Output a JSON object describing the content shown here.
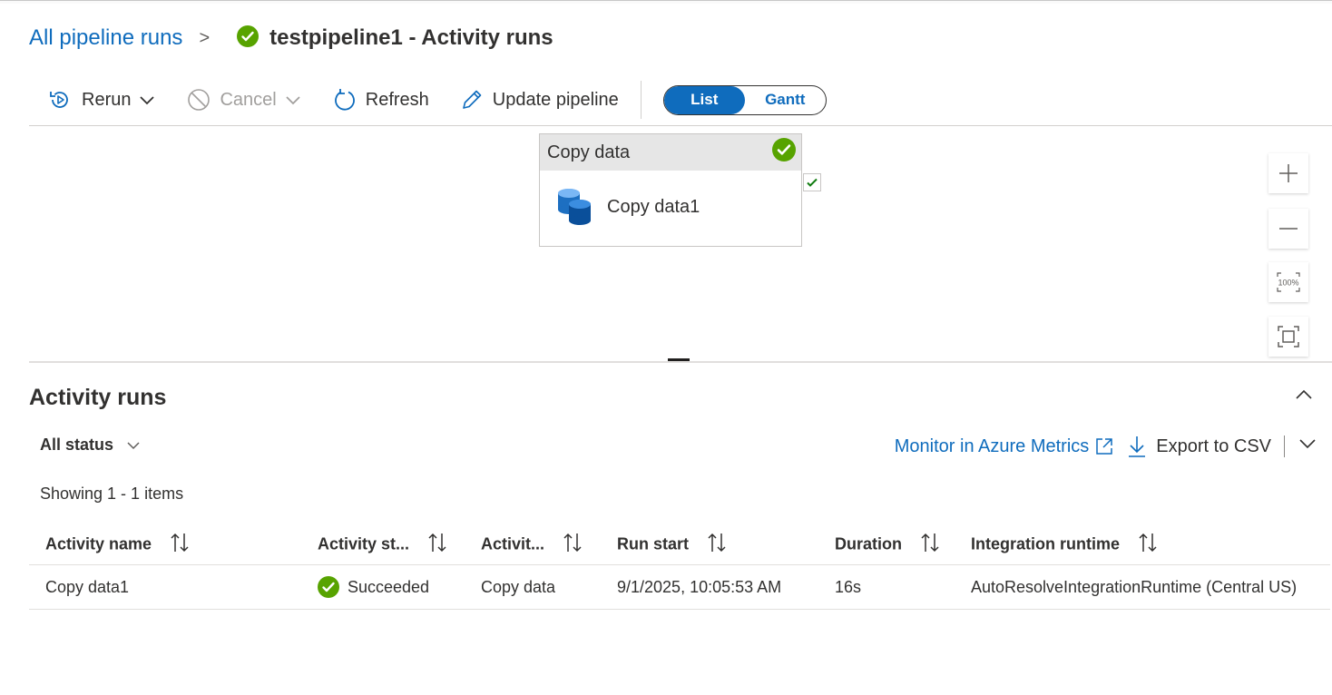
{
  "breadcrumb": {
    "parent": "All pipeline runs",
    "separator": ">",
    "title": "testpipeline1 - Activity runs"
  },
  "toolbar": {
    "rerun": "Rerun",
    "cancel": "Cancel",
    "refresh": "Refresh",
    "update_pipeline": "Update pipeline",
    "view_toggle": {
      "list": "List",
      "gantt": "Gantt",
      "selected": "List"
    }
  },
  "canvas": {
    "node": {
      "type_label": "Copy data",
      "name": "Copy data1",
      "status": "succeeded"
    },
    "zoom_controls": [
      "zoom-in",
      "zoom-out",
      "zoom-100",
      "fit-to-screen"
    ],
    "zoom_100_label": "100%"
  },
  "activity_runs": {
    "title": "Activity runs",
    "status_filter": "All status",
    "monitor_link": "Monitor in Azure Metrics",
    "export": "Export to CSV",
    "showing": "Showing 1 - 1 items",
    "columns": [
      "Activity name",
      "Activity st...",
      "Activit...",
      "Run start",
      "Duration",
      "Integration runtime"
    ],
    "rows": [
      {
        "activity_name": "Copy data1",
        "status": "Succeeded",
        "activity_type": "Copy data",
        "run_start": "9/1/2025, 10:05:53 AM",
        "duration": "16s",
        "integration_runtime": "AutoResolveIntegrationRuntime (Central US)"
      }
    ]
  },
  "colors": {
    "accent": "#0f6cbd",
    "success": "#57a300",
    "text": "#323130",
    "disabled": "#a19f9d"
  }
}
